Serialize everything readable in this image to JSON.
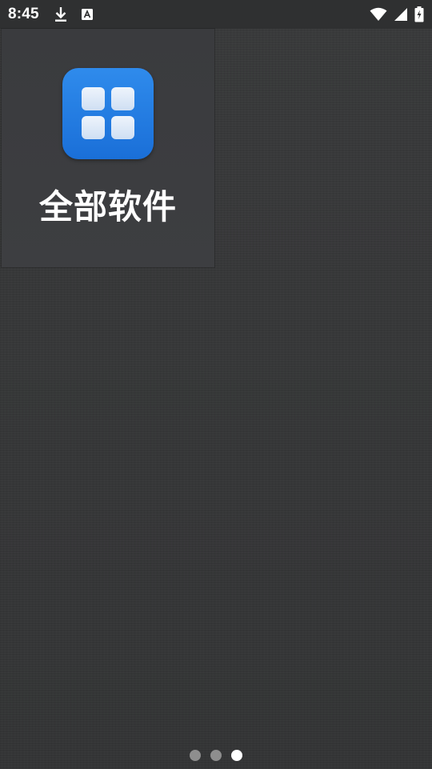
{
  "status_bar": {
    "time": "8:45",
    "left_icons": [
      "download-icon",
      "keyboard-a-icon"
    ],
    "right_icons": [
      "wifi-icon",
      "signal-icon",
      "battery-charging-icon"
    ]
  },
  "home": {
    "tile": {
      "label": "全部软件",
      "icon": "grid-apps-icon",
      "icon_color": "#1f78e0"
    }
  },
  "page_indicator": {
    "count": 3,
    "active_index": 2
  },
  "colors": {
    "background": "#363738",
    "status_bar": "#2f3031",
    "tile_background": "#3c3d40",
    "dot_inactive": "#8e8e8e",
    "dot_active": "#ffffff"
  }
}
